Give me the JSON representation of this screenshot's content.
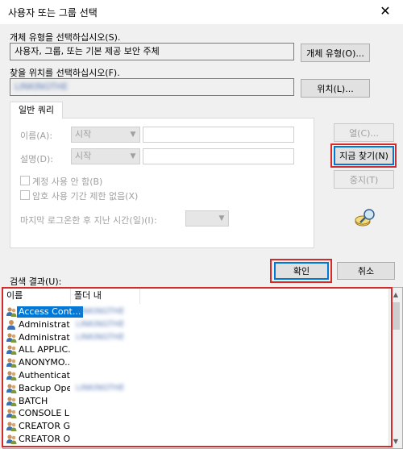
{
  "window": {
    "title": "사용자 또는 그룹 선택",
    "close_glyph": "✕"
  },
  "object_type": {
    "label": "개체 유형을 선택하십시오(S).",
    "value": "사용자, 그룹, 또는 기본 제공 보안 주체",
    "button": "개체 유형(O)..."
  },
  "location": {
    "label": "찾을 위치를 선택하십시오(F).",
    "value": "LINKINGTHE",
    "button": "위치(L)..."
  },
  "tab": {
    "label": "일반 쿼리"
  },
  "query": {
    "name_label": "이름(A):",
    "name_mode": "시작",
    "desc_label": "설명(D):",
    "desc_mode": "시작",
    "disabled_account": "계정 사용 안 함(B)",
    "no_expire_pw": "암호 사용 기간 제한 없음(X)",
    "days_since_logon": "마지막 로그온한 후 지난 시간(일)(I):"
  },
  "side_buttons": {
    "columns": "열(C)...",
    "find_now": "지금 찾기(N)",
    "stop": "중지(T)"
  },
  "ok_button": "확인",
  "cancel_button": "취소",
  "results": {
    "label": "검색 결과(U):",
    "col_name": "이름",
    "col_folder": "폴더 내",
    "rows": [
      {
        "name": "Access Cont...",
        "folder": "LINKINGTHE",
        "icon": "group-icon",
        "selected": true
      },
      {
        "name": "Administrator",
        "folder": "LINKINGTHE",
        "icon": "user-icon"
      },
      {
        "name": "Administrat...",
        "folder": "LINKINGTHE",
        "icon": "group-icon"
      },
      {
        "name": "ALL APPLIC...",
        "folder": "",
        "icon": "group-icon"
      },
      {
        "name": "ANONYMO...",
        "folder": "",
        "icon": "group-icon"
      },
      {
        "name": "Authenticat...",
        "folder": "",
        "icon": "group-icon"
      },
      {
        "name": "Backup Ope...",
        "folder": "LINKINGTHE",
        "icon": "group-icon"
      },
      {
        "name": "BATCH",
        "folder": "",
        "icon": "group-icon"
      },
      {
        "name": "CONSOLE L...",
        "folder": "",
        "icon": "group-icon"
      },
      {
        "name": "CREATOR G...",
        "folder": "",
        "icon": "group-icon"
      },
      {
        "name": "CREATOR O...",
        "folder": "",
        "icon": "group-icon"
      }
    ]
  },
  "colors": {
    "highlight": "#d42a2a",
    "selection": "#0078d7",
    "focus": "#0078d7"
  }
}
